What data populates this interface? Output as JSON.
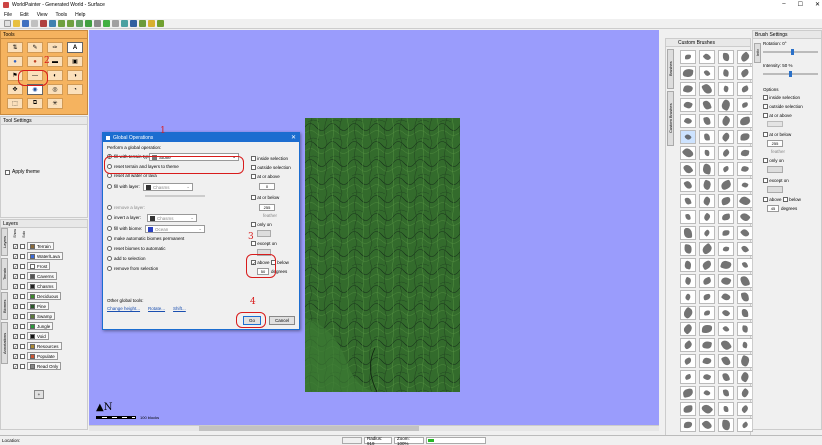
{
  "window": {
    "title": "WorldPainter - Generated World - Surface"
  },
  "menu": [
    "File",
    "Edit",
    "View",
    "Tools",
    "Help"
  ],
  "panels": {
    "tools": {
      "title": "Tools"
    },
    "tool_settings": {
      "title": "Tool Settings",
      "apply_theme": "Apply theme"
    },
    "layers": {
      "title": "Layers",
      "col_show": "Show",
      "col_solo": "Solo",
      "side_tabs": [
        "Layers",
        "Terrain",
        "Biomes",
        "Annotations"
      ],
      "items": [
        {
          "name": "Terrain",
          "color": "#8a6a3a"
        },
        {
          "name": "Water/Lava",
          "color": "#3a6ad8"
        },
        {
          "name": "Frost",
          "color": "#ffffff"
        },
        {
          "name": "Caverns",
          "color": "#555555"
        },
        {
          "name": "Chasms",
          "color": "#222222"
        },
        {
          "name": "Deciduous",
          "color": "#3a8a2a"
        },
        {
          "name": "Pine",
          "color": "#2a5a2a"
        },
        {
          "name": "Swamp",
          "color": "#5a7a3a"
        },
        {
          "name": "Jungle",
          "color": "#2a9a3a"
        },
        {
          "name": "Void",
          "color": "#111111"
        },
        {
          "name": "Resources",
          "color": "#aa8833"
        },
        {
          "name": "Populate",
          "color": "#cc5533"
        },
        {
          "name": "Read Only",
          "color": "#888888"
        }
      ],
      "add_button": "+"
    },
    "custom_brushes": {
      "title": "Custom Brushes",
      "tabs": [
        "Brushes",
        "Custom Brushes"
      ]
    },
    "brush_settings": {
      "title": "Brush Settings",
      "rotation": "Rotation: 0°",
      "intensity": "Intensity: 50 %",
      "side_tab": "Info",
      "options_title": "Options",
      "inside_selection": "inside selection",
      "outside_selection": "outside selection",
      "at_or_above": "at or above",
      "at_or_below": "at or below",
      "below_value": "255",
      "feather": "feather",
      "only_on": "only on",
      "except_on": "except on",
      "above": "above",
      "below": "below",
      "degrees_value": "45",
      "degrees": "degrees"
    }
  },
  "dialog": {
    "title": "Global Operations",
    "perform": "Perform a global operation:",
    "ops": {
      "fill_terrain": "fill with terrain type:",
      "terrain_value": "Stone",
      "reset_terrain": "reset terrain and layers to theme",
      "reset_water": "reset all water or lava",
      "fill_layer": "fill with layer:",
      "layer_value": "Chasms",
      "remove_layer": "remove a layer:",
      "invert_layer": "invert a layer:",
      "invert_value": "Chasms",
      "fill_biome": "fill with biome:",
      "biome_value": "Ocean",
      "make_auto": "make automatic biomes permanent",
      "reset_biomes": "reset biomes to automatic",
      "add_selection": "add to selection",
      "remove_selection": "remove from selection"
    },
    "right": {
      "inside_selection": "inside selection",
      "outside_selection": "outside selection",
      "at_or_above": "at or above",
      "above_value": "0",
      "at_or_below": "at or below",
      "below_value": "255",
      "feather": "feather",
      "only_on": "only on",
      "except_on": "except on",
      "above": "above",
      "below": "below",
      "degrees_value": "50",
      "degrees": "degrees"
    },
    "other_tools": "Other global tools:",
    "links": [
      "Change height...",
      "Rotate...",
      "Shift..."
    ],
    "go": "Go",
    "cancel": "Cancel"
  },
  "annotations": [
    "1",
    "2",
    "3",
    "4"
  ],
  "canvas": {
    "scale_label": "100 blocks",
    "compass": "N"
  },
  "status": {
    "location": "Location:",
    "radius": "Radius: 919",
    "zoom": "Zoom: 100%"
  }
}
